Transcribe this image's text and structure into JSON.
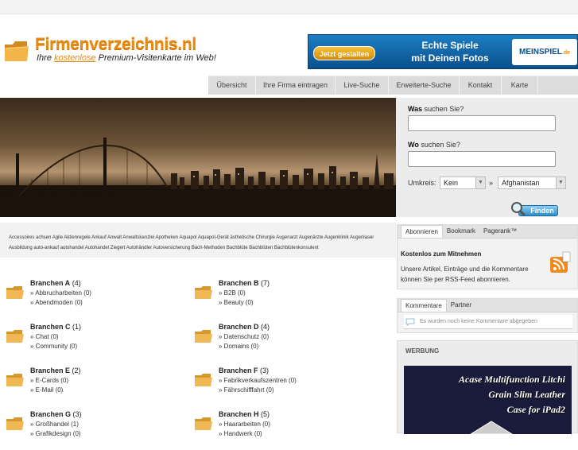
{
  "header": {
    "logo_title": "Firmenverzeichnis.nl",
    "logo_sub_before": "Ihre ",
    "logo_sub_highlight": "kostenlose",
    "logo_sub_after": " Premium-Visitenkarte im Web!"
  },
  "ad_banner": {
    "button": "Jetzt gestalten",
    "line1": "Echte Spiele",
    "line2": "mit Deinen Fotos",
    "brand": "MEINSPIEL",
    "brand_suffix": ".de"
  },
  "nav": {
    "items": [
      "Übersicht",
      "Ihre Firma eintragen",
      "Live-Suche",
      "Erweiterte-Suche",
      "Kontakt",
      "Karte"
    ]
  },
  "search": {
    "was_bold": "Was",
    "was_rest": " suchen Sie?",
    "wo_bold": "Wo",
    "wo_rest": " suchen Sie?",
    "umkreis_label": "Umkreis:",
    "umkreis_value": "Kein",
    "separator": "»",
    "country_value": "Afghanistan",
    "find_button": "Finden"
  },
  "tags": {
    "text": "Accessoires achsen Agile Aktienregele Ankauf Anwalt Anwaltskanzlei Apotheken Aquapol Aquapol-Gerät ästhetische Chirurgie Augenarzt Augenärzte Augenklinik Augenlaser Ausbildung auto-ankauf autohandel Autohandel Ziegert Autohändler Autoversicherung Bach-Methoden Bachblüte Bachblüten Bachblütenkonsulent"
  },
  "sidebar": {
    "tabs1": [
      "Abonnieren",
      "Bookmark",
      "Pagerank™"
    ],
    "rss_title": "Kostenlos zum Mitnehmen",
    "rss_text": "Unsere Artikel, Einträge und die Kommentare können Sie per RSS-Feed abonnieren.",
    "tabs2": [
      "Kommentare",
      "Partner"
    ],
    "no_comments": "Es wurden noch keine Kommentare abgegeben",
    "werbung_title": "WERBUNG",
    "werbung_ad": [
      "Acase Multifunction Litchi",
      "Grain Slim Leather",
      "Case for iPad2"
    ]
  },
  "categories": [
    {
      "title": "Branchen A",
      "count": "(4)",
      "items": [
        "» Abbrucharbeiten (0)",
        "» Abendmoden (0)"
      ]
    },
    {
      "title": "Branchen B",
      "count": "(7)",
      "items": [
        "» B2B (0)",
        "» Beauty (0)"
      ]
    },
    {
      "title": "Branchen C",
      "count": "(1)",
      "items": [
        "» Chat (0)",
        "» Community (0)"
      ]
    },
    {
      "title": "Branchen D",
      "count": "(4)",
      "items": [
        "» Datenschutz (0)",
        "» Domains (0)"
      ]
    },
    {
      "title": "Branchen E",
      "count": "(2)",
      "items": [
        "» E-Cards (0)",
        "» E-Mail (0)"
      ]
    },
    {
      "title": "Branchen F",
      "count": "(3)",
      "items": [
        "» Fabrikverkaufszentren (0)",
        "» Fährschifffahrt (0)"
      ]
    },
    {
      "title": "Branchen G",
      "count": "(3)",
      "items": [
        "» Großhandel (1)",
        "» Grafikdesign (0)"
      ]
    },
    {
      "title": "Branchen H",
      "count": "(5)",
      "items": [
        "» Haararbeiten (0)",
        "» Handwerk (0)"
      ]
    }
  ],
  "colors": {
    "accent": "#e88a10",
    "nav_bg": "#dcdcdc",
    "ad_blue": "#1d7fc4"
  }
}
